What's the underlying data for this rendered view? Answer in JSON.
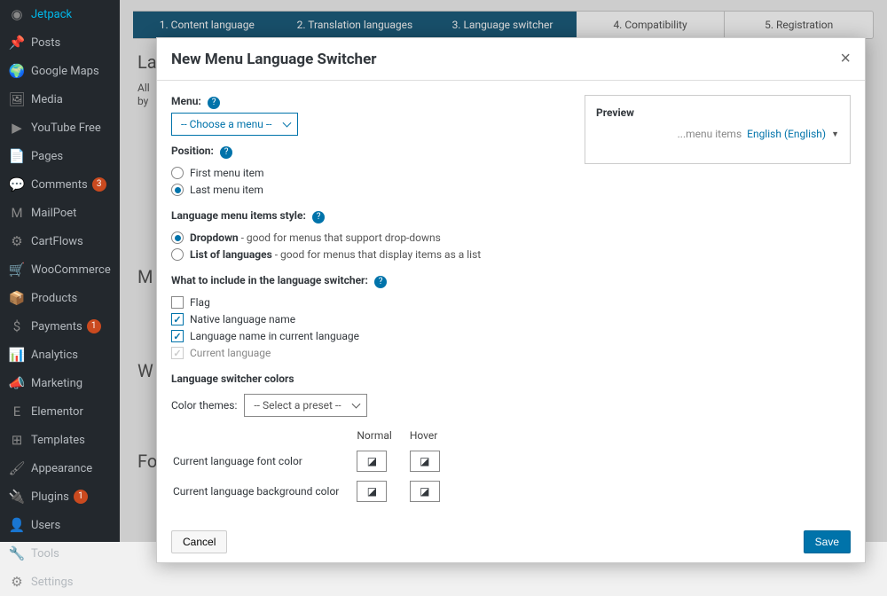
{
  "sidebar": {
    "items": [
      {
        "icon": "◉",
        "label": "Jetpack"
      },
      {
        "icon": "📌",
        "label": "Posts"
      },
      {
        "icon": "🌍",
        "label": "Google Maps"
      },
      {
        "icon": "🖼",
        "label": "Media"
      },
      {
        "icon": "▶",
        "label": "YouTube Free"
      },
      {
        "icon": "📄",
        "label": "Pages"
      },
      {
        "icon": "💬",
        "label": "Comments",
        "badge": "3"
      },
      {
        "icon": "M",
        "label": "MailPoet"
      },
      {
        "icon": "⚙",
        "label": "CartFlows"
      },
      {
        "icon": "🛒",
        "label": "WooCommerce"
      },
      {
        "icon": "📦",
        "label": "Products"
      },
      {
        "icon": "$",
        "label": "Payments",
        "badge": "1"
      },
      {
        "icon": "📊",
        "label": "Analytics"
      },
      {
        "icon": "📣",
        "label": "Marketing"
      },
      {
        "icon": "E",
        "label": "Elementor"
      },
      {
        "icon": "⊞",
        "label": "Templates"
      },
      {
        "icon": "🖌",
        "label": "Appearance"
      },
      {
        "icon": "🔌",
        "label": "Plugins",
        "badge": "1"
      },
      {
        "icon": "👤",
        "label": "Users"
      },
      {
        "icon": "🔧",
        "label": "Tools"
      },
      {
        "icon": "⚙",
        "label": "Settings"
      }
    ]
  },
  "steps": [
    {
      "label": "1. Content language",
      "active": true
    },
    {
      "label": "2. Translation languages",
      "active": true
    },
    {
      "label": "3. Language switcher",
      "active": true
    },
    {
      "label": "4. Compatibility",
      "active": false
    },
    {
      "label": "5. Registration",
      "active": false
    }
  ],
  "bg": {
    "heading": "La",
    "all": "All",
    "by": "by",
    "m": "M",
    "w": "W",
    "f": "Fo"
  },
  "modal": {
    "title": "New Menu Language Switcher",
    "close": "×",
    "menu_label": "Menu:",
    "menu_select": "-- Choose a menu --",
    "position_label": "Position:",
    "position_opts": [
      "First menu item",
      "Last menu item"
    ],
    "position_selected": 1,
    "style_label": "Language menu items style:",
    "style_opts": [
      {
        "bold": "Dropdown",
        "desc": " - good for menus that support drop-downs"
      },
      {
        "bold": "List of languages",
        "desc": " - good for menus that display items as a list"
      }
    ],
    "style_selected": 0,
    "include_label": "What to include in the language switcher:",
    "include_opts": [
      {
        "label": "Flag",
        "checked": false
      },
      {
        "label": "Native language name",
        "checked": true
      },
      {
        "label": "Language name in current language",
        "checked": true
      },
      {
        "label": "Current language",
        "checked": true,
        "disabled": true
      }
    ],
    "colors_label": "Language switcher colors",
    "themes_label": "Color themes:",
    "themes_select": "-- Select a preset --",
    "col_normal": "Normal",
    "col_hover": "Hover",
    "row_font": "Current language font color",
    "row_bg": "Current language background color",
    "cancel": "Cancel",
    "save": "Save",
    "preview": {
      "title": "Preview",
      "menu_items": "...menu items",
      "language": "English (English)",
      "caret": "▼"
    }
  }
}
